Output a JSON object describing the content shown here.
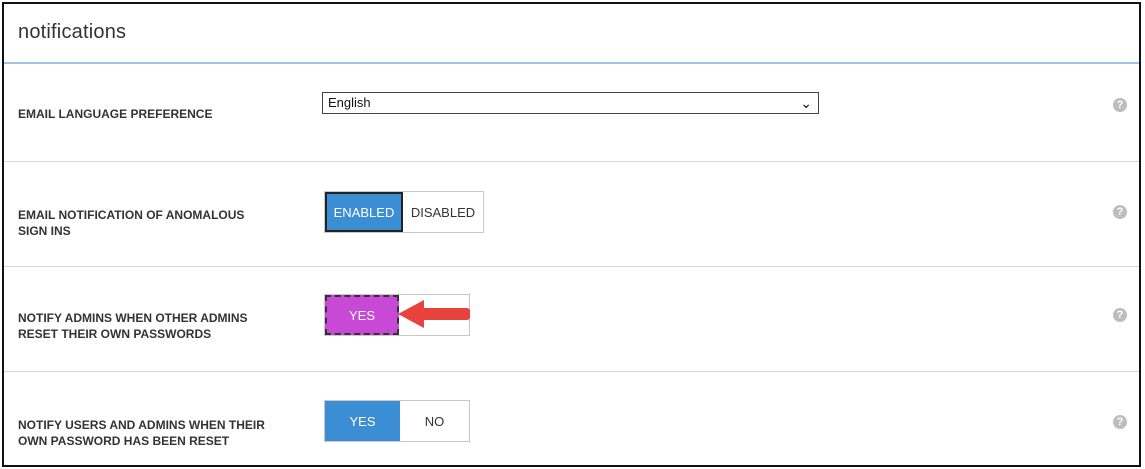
{
  "panel": {
    "title": "notifications",
    "help_icon": "help-icon",
    "help_glyph": "?"
  },
  "rows": [
    {
      "label": "EMAIL LANGUAGE PREFERENCE",
      "control": "select",
      "select_value": "English"
    },
    {
      "label_line1": "EMAIL NOTIFICATION OF ANOMALOUS",
      "label_line2": "SIGN INS",
      "control": "toggle",
      "options": [
        "ENABLED",
        "DISABLED"
      ],
      "selected": "ENABLED"
    },
    {
      "label_line1": "NOTIFY ADMINS WHEN OTHER ADMINS",
      "label_line2": "RESET THEIR OWN PASSWORDS",
      "control": "toggle",
      "options": [
        "YES",
        ""
      ],
      "selected": "YES",
      "highlighted": true
    },
    {
      "label_line1": "NOTIFY USERS AND ADMINS WHEN THEIR",
      "label_line2": "OWN PASSWORD HAS BEEN RESET",
      "control": "toggle",
      "options": [
        "YES",
        "NO"
      ],
      "selected": "YES"
    }
  ],
  "colors": {
    "accent_blue": "#3b8ed4",
    "highlight_magenta": "#c849d6",
    "annotation_arrow": "#e8423f",
    "header_rule": "#9dc3e6"
  }
}
